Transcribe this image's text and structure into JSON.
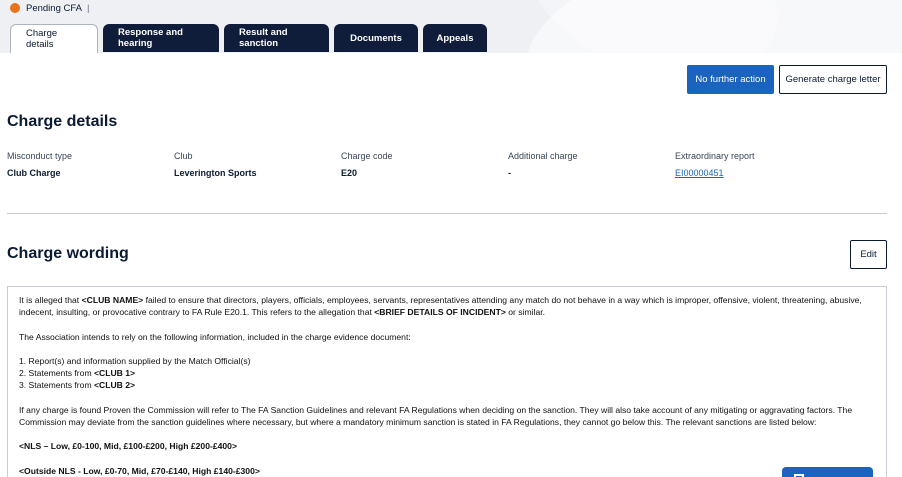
{
  "status": {
    "label": "Pending CFA",
    "separator": "|",
    "color": "#e8731a"
  },
  "tabs": [
    {
      "label": "Charge details",
      "active": true
    },
    {
      "label": "Response and hearing",
      "active": false
    },
    {
      "label": "Result and sanction",
      "active": false
    },
    {
      "label": "Documents",
      "active": false
    },
    {
      "label": "Appeals",
      "active": false
    }
  ],
  "actions": {
    "no_further_action": "No further action",
    "generate_charge_letter": "Generate charge letter"
  },
  "charge_details": {
    "title": "Charge details",
    "fields": [
      {
        "label": "Misconduct type",
        "value": "Club Charge"
      },
      {
        "label": "Club",
        "value": "Leverington Sports"
      },
      {
        "label": "Charge code",
        "value": "E20"
      },
      {
        "label": "Additional charge",
        "value": "-"
      },
      {
        "label": "Extraordinary report",
        "value": "EI00000451"
      }
    ]
  },
  "charge_wording": {
    "title": "Charge wording",
    "edit_label": "Edit",
    "p1_a": "It is alleged that ",
    "p1_club": "<CLUB NAME>",
    "p1_b": " failed to ensure that directors, players, officials, employees, servants, representatives attending any match do not behave in a way which is improper, offensive, violent, threatening, abusive, indecent, insulting, or provocative contrary to FA Rule E20.1. This refers to the allegation that ",
    "p1_brief": "<BRIEF DETAILS OF INCIDENT>",
    "p1_c": " or similar.",
    "p2": "The Association intends to rely on the following information, included in the charge evidence document:",
    "list1": "1. Report(s) and information supplied by the Match Official(s)",
    "list2_a": "2. Statements from ",
    "list2_b": "<CLUB 1>",
    "list3_a": "3. Statements from ",
    "list3_b": "<CLUB 2>",
    "p3": "If any charge is found Proven the Commission will refer to The FA Sanction Guidelines and relevant FA Regulations when deciding on the sanction. They will also take account of any mitigating or aggravating factors. The Commission may deviate from the sanction guidelines where necessary, but where a mandatory minimum sanction is stated in FA Regulations, they cannot go below this. The relevant sanctions are listed below:",
    "nls": "<NLS – Low, £0-100, Mid, £100-£200, High £200-£400>",
    "outside_nls": "<Outside NLS - Low, £0-70, Mid, £70-£140, High £140-£300>"
  },
  "colors": {
    "primary": "#1a64c0",
    "navy": "#0f1d3a"
  }
}
